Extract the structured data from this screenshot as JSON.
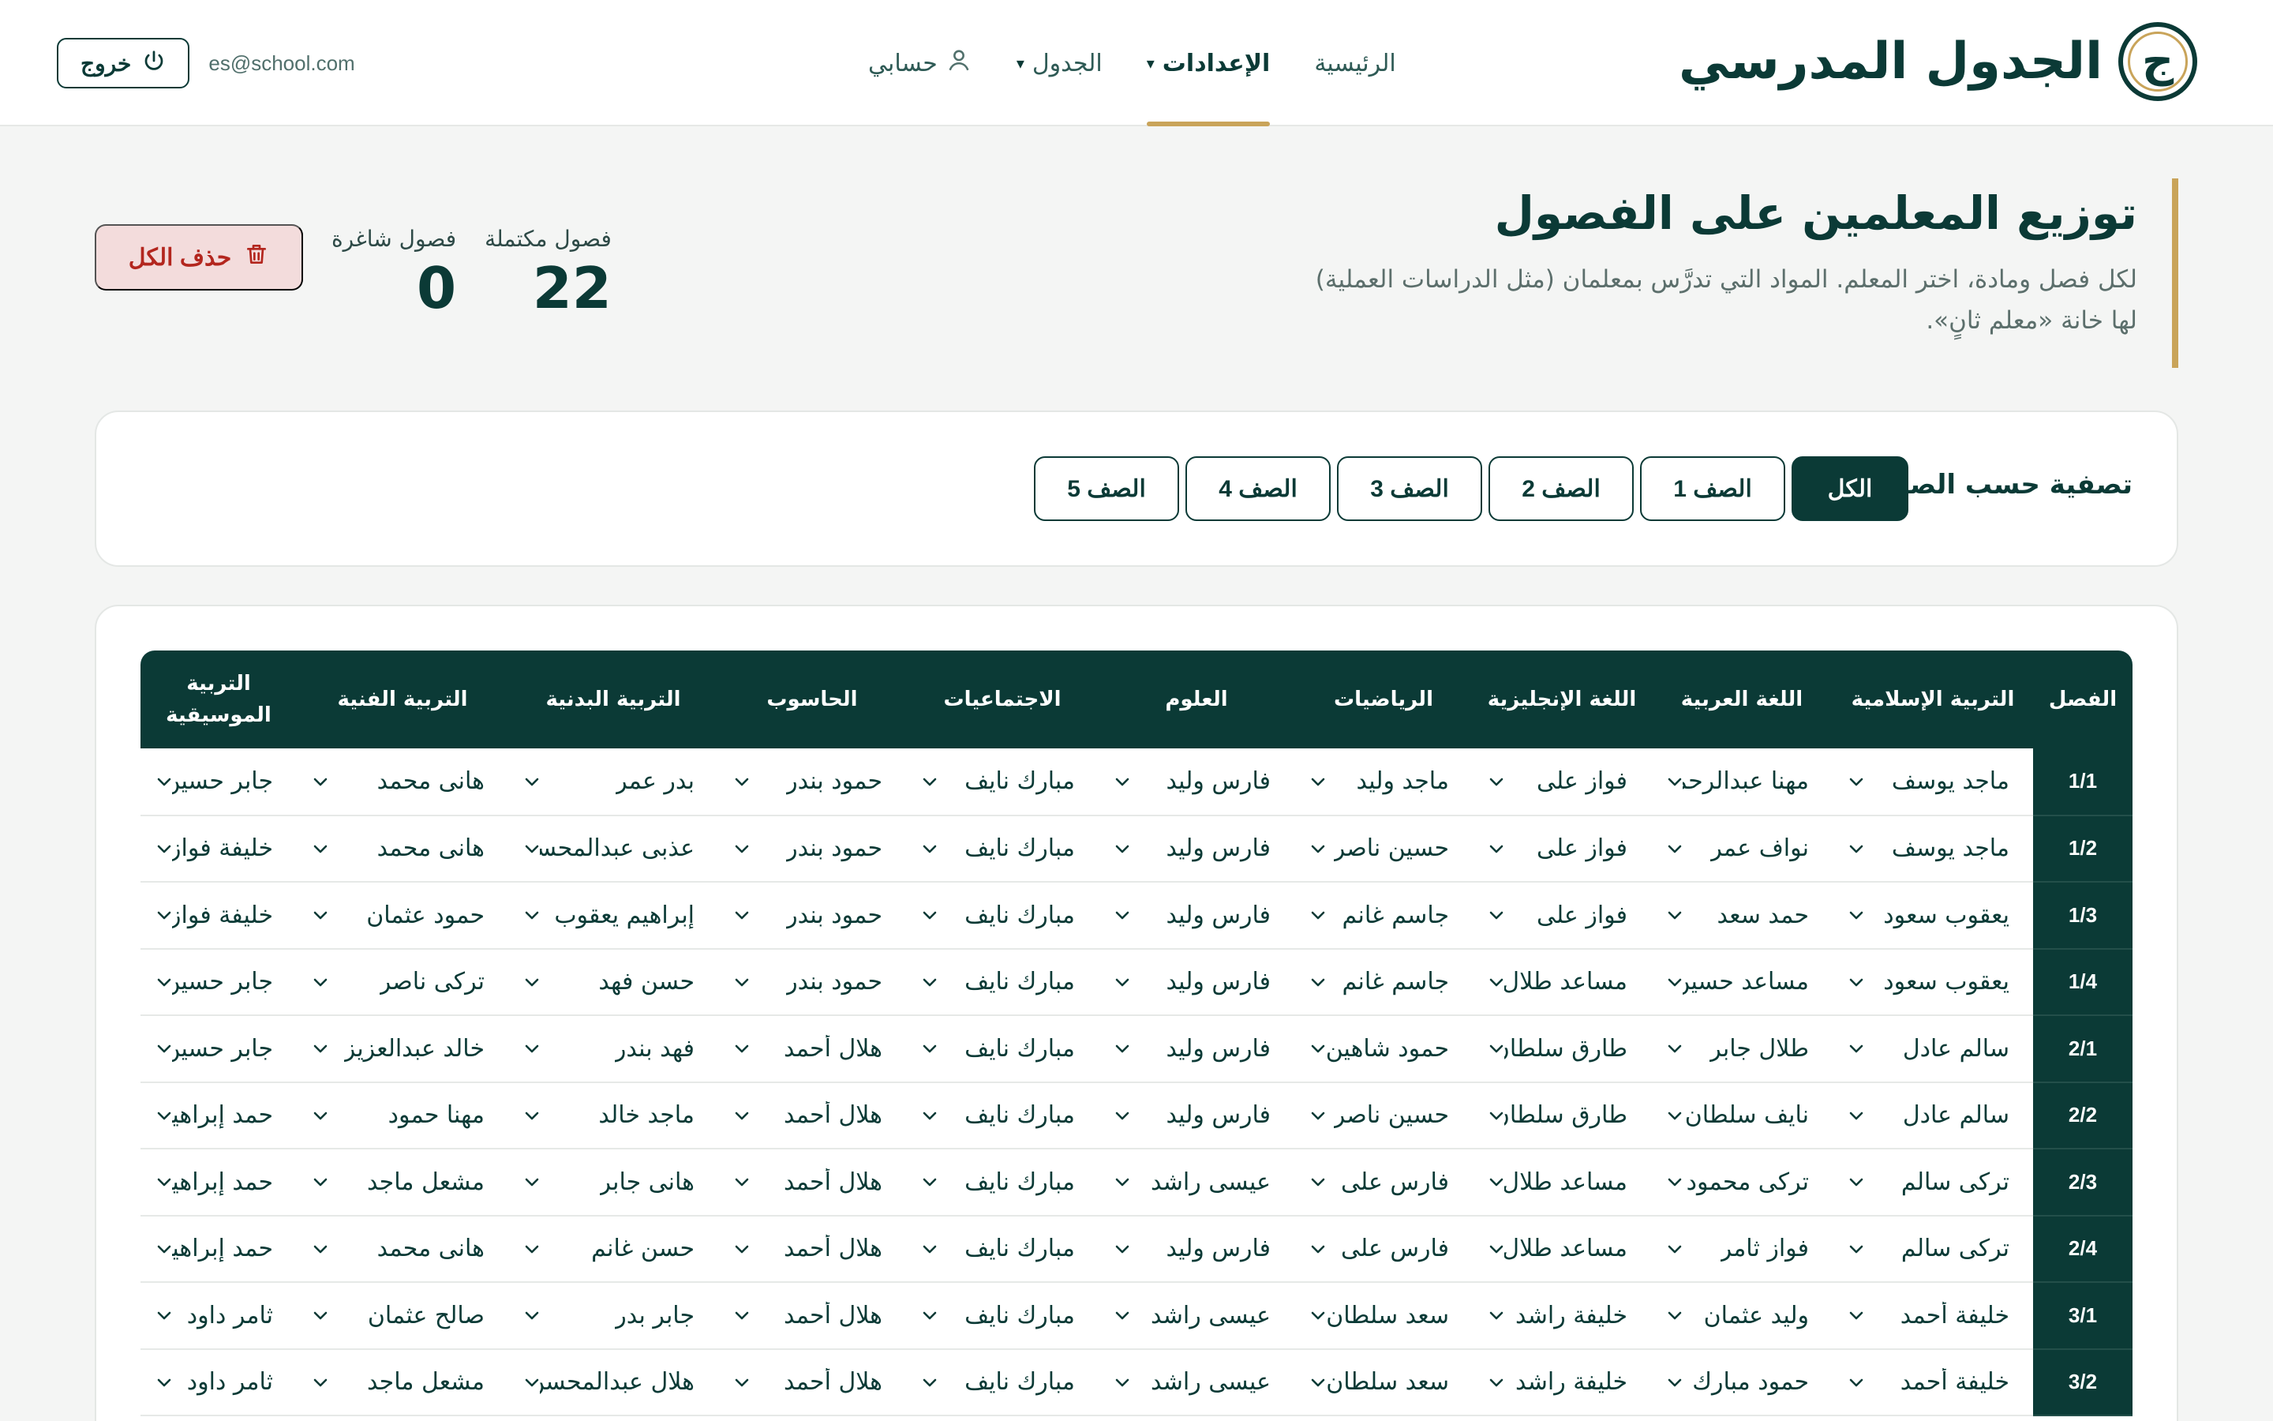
{
  "header": {
    "brand_initial": "ج",
    "brand_title": "الجدول المدرسي",
    "nav": [
      {
        "label": "الرئيسية",
        "active": false,
        "dropdown": false
      },
      {
        "label": "الإعدادات",
        "active": true,
        "dropdown": true
      },
      {
        "label": "الجدول",
        "active": false,
        "dropdown": true
      },
      {
        "label": "حسابي",
        "active": false,
        "dropdown": false,
        "icon": "person-icon"
      }
    ],
    "user_email": "es@school.com",
    "logout_label": "خروج",
    "logout_icon": "power-icon"
  },
  "page": {
    "title": "توزيع المعلمين على الفصول",
    "description": "لكل فصل ومادة، اختر المعلم. المواد التي تدرَّس بمعلمان (مثل الدراسات العملية) لها خانة «معلم ثانٍ».",
    "stats": {
      "complete_label": "فصول مكتملة",
      "complete_value": "22",
      "vacant_label": "فصول شاغرة",
      "vacant_value": "0"
    },
    "delete_all_label": "حذف الكل",
    "delete_icon": "trash-icon"
  },
  "filter": {
    "label": "تصفية حسب الصف:",
    "options": [
      "الكل",
      "الصف 1",
      "الصف 2",
      "الصف 3",
      "الصف 4",
      "الصف 5"
    ],
    "selected": "الكل"
  },
  "table": {
    "columns": [
      "الفصل",
      "التربية الإسلامية",
      "اللغة العربية",
      "اللغة الإنجليزية",
      "الرياضيات",
      "العلوم",
      "الاجتماعيات",
      "الحاسوب",
      "التربية البدنية",
      "التربية الفنية",
      "التربية الموسيقية"
    ],
    "rows": [
      {
        "class": "1/1",
        "cells": [
          "ماجد يوسف",
          "مهنا عبدالرحمن",
          "فواز على",
          "ماجد وليد",
          "فارس وليد",
          "مبارك نايف",
          "حمود بندر",
          "بدر عمر",
          "هانى محمد",
          "جابر حسين"
        ]
      },
      {
        "class": "1/2",
        "cells": [
          "ماجد يوسف",
          "نواف عمر",
          "فواز على",
          "حسين ناصر",
          "فارس وليد",
          "مبارك نايف",
          "حمود بندر",
          "عذبى عبدالمحسن",
          "هانى محمد",
          "خليفة فواز"
        ]
      },
      {
        "class": "1/3",
        "cells": [
          "يعقوب سعود",
          "حمد سعد",
          "فواز على",
          "جاسم غانم",
          "فارس وليد",
          "مبارك نايف",
          "حمود بندر",
          "إبراهيم يعقوب",
          "حمود عثمان",
          "خليفة فواز"
        ]
      },
      {
        "class": "1/4",
        "cells": [
          "يعقوب سعود",
          "مساعد حسين",
          "مساعد طلال",
          "جاسم غانم",
          "فارس وليد",
          "مبارك نايف",
          "حمود بندر",
          "حسن فهد",
          "تركى ناصر",
          "جابر حسين"
        ]
      },
      {
        "class": "2/1",
        "cells": [
          "سالم عادل",
          "طلال جابر",
          "طارق سلطان",
          "حمود شاهين",
          "فارس وليد",
          "مبارك نايف",
          "هلال أحمد",
          "فهد بندر",
          "خالد عبدالعزيز",
          "جابر حسين"
        ]
      },
      {
        "class": "2/2",
        "cells": [
          "سالم عادل",
          "نايف سلطان",
          "طارق سلطان",
          "حسين ناصر",
          "فارس وليد",
          "مبارك نايف",
          "هلال أحمد",
          "ماجد خالد",
          "مهنا حمود",
          "حمد إبراهيم"
        ]
      },
      {
        "class": "2/3",
        "cells": [
          "تركى سالم",
          "تركى محمود",
          "مساعد طلال",
          "فارس على",
          "عيسى راشد",
          "مبارك نايف",
          "هلال أحمد",
          "هانى جابر",
          "مشعل ماجد",
          "حمد إبراهيم"
        ]
      },
      {
        "class": "2/4",
        "cells": [
          "تركى سالم",
          "فواز ثامر",
          "مساعد طلال",
          "فارس على",
          "فارس وليد",
          "مبارك نايف",
          "هلال أحمد",
          "حسن غانم",
          "هانى محمد",
          "حمد إبراهيم"
        ]
      },
      {
        "class": "3/1",
        "cells": [
          "خليفة أحمد",
          "وليد عثمان",
          "خليفة راشد",
          "سعد سلطان",
          "عيسى راشد",
          "مبارك نايف",
          "هلال أحمد",
          "جابر بدر",
          "صالح عثمان",
          "ثامر داود"
        ]
      },
      {
        "class": "3/2",
        "cells": [
          "خليفة أحمد",
          "حمود مبارك",
          "خليفة راشد",
          "سعد سلطان",
          "عيسى راشد",
          "مبارك نايف",
          "هلال أحمد",
          "هلال عبدالمحسن",
          "مشعل ماجد",
          "ثامر داود"
        ]
      }
    ],
    "select_icon": "chevron-down-icon"
  },
  "colors": {
    "primary": "#0b3a36",
    "accent_gold": "#c9a45a",
    "danger": "#b3261e",
    "danger_bg": "#f3dcdc"
  }
}
